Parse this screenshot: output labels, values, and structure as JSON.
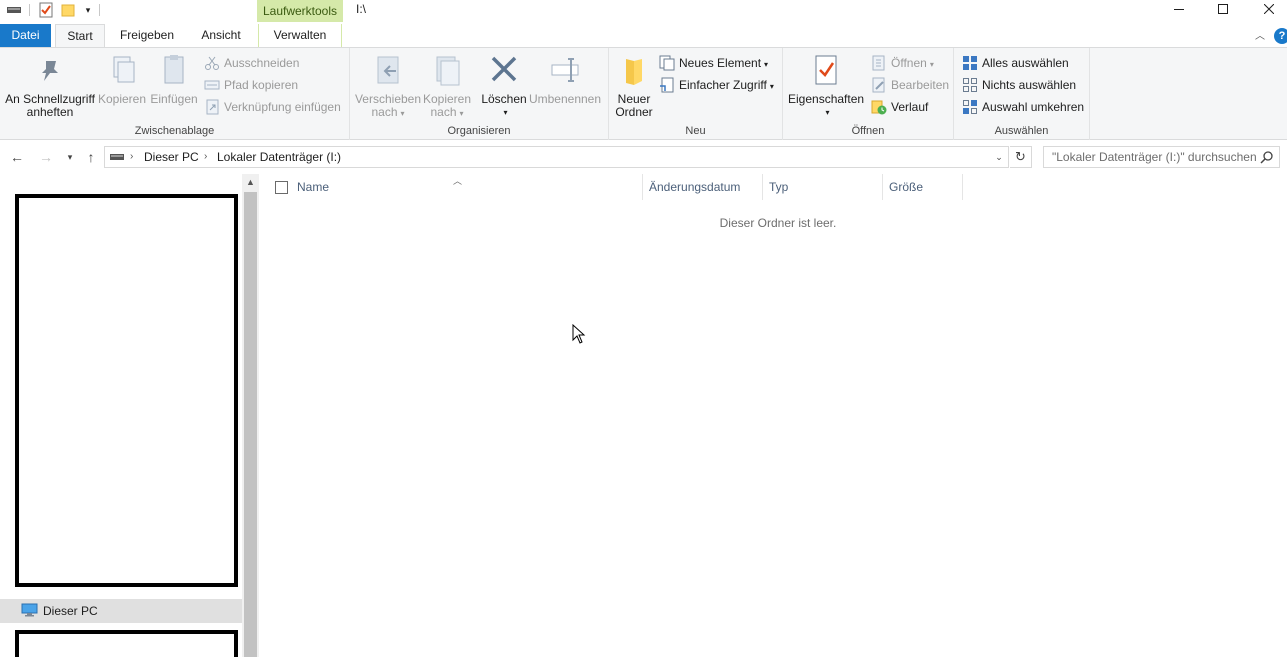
{
  "window": {
    "title": "I:\\",
    "contextual_tab_header": "Laufwerktools"
  },
  "ribbon_tabs": {
    "datei": "Datei",
    "start": "Start",
    "freigeben": "Freigeben",
    "ansicht": "Ansicht",
    "verwalten": "Verwalten"
  },
  "ribbon": {
    "zwischenablage": {
      "label": "Zwischenablage",
      "pin_line1": "An Schnellzugriff",
      "pin_line2": "anheften",
      "copy": "Kopieren",
      "paste": "Einfügen",
      "cut": "Ausschneiden",
      "copy_path": "Pfad kopieren",
      "paste_shortcut": "Verknüpfung einfügen"
    },
    "organisieren": {
      "label": "Organisieren",
      "move_line1": "Verschieben",
      "move_line2": "nach",
      "copyto_line1": "Kopieren",
      "copyto_line2": "nach",
      "delete": "Löschen",
      "rename": "Umbenennen"
    },
    "neu": {
      "label": "Neu",
      "new_folder_line1": "Neuer",
      "new_folder_line2": "Ordner",
      "new_item": "Neues Element",
      "easy_access": "Einfacher Zugriff"
    },
    "oeffnen": {
      "label": "Öffnen",
      "properties": "Eigenschaften",
      "open": "Öffnen",
      "edit": "Bearbeiten",
      "history": "Verlauf"
    },
    "auswaehlen": {
      "label": "Auswählen",
      "select_all": "Alles auswählen",
      "select_none": "Nichts auswählen",
      "invert": "Auswahl umkehren"
    }
  },
  "address": {
    "crumb1": "Dieser PC",
    "crumb2": "Lokaler Datenträger (I:)",
    "search_placeholder": "\"Lokaler Datenträger (I:)\" durchsuchen"
  },
  "nav_pane": {
    "this_pc": "Dieser PC"
  },
  "columns": {
    "name": "Name",
    "date": "Änderungsdatum",
    "type": "Typ",
    "size": "Größe"
  },
  "content": {
    "empty_message": "Dieser Ordner ist leer."
  },
  "colors": {
    "accent": "#1979ca",
    "contextual": "#d5e9a9",
    "ribbon_bg": "#f5f6f7"
  }
}
